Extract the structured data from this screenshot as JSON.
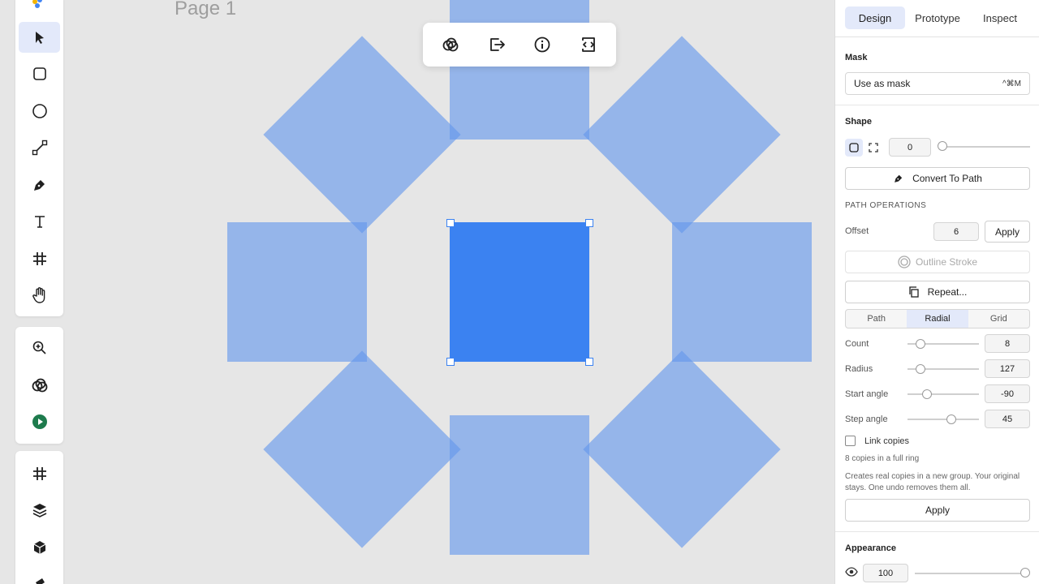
{
  "canvas": {
    "page_label": "Page 1"
  },
  "panel": {
    "tabs": [
      {
        "label": "Design",
        "active": true
      },
      {
        "label": "Prototype",
        "active": false
      },
      {
        "label": "Inspect",
        "active": false
      }
    ],
    "mask": {
      "title": "Mask",
      "use_as_mask": "Use as mask",
      "shortcut": "^⌘M"
    },
    "shape": {
      "title": "Shape",
      "corner_radius": "0",
      "convert_to_path": "Convert To Path",
      "path_operations_title": "PATH OPERATIONS",
      "offset_label": "Offset",
      "offset_value": "6",
      "offset_apply": "Apply",
      "outline_stroke": "Outline Stroke",
      "repeat": "Repeat..."
    },
    "repeat": {
      "modes": [
        {
          "label": "Path",
          "active": false
        },
        {
          "label": "Radial",
          "active": true
        },
        {
          "label": "Grid",
          "active": false
        }
      ],
      "count_label": "Count",
      "count_value": "8",
      "radius_label": "Radius",
      "radius_value": "127",
      "start_label": "Start angle",
      "start_value": "-90",
      "step_label": "Step angle",
      "step_value": "45",
      "link_copies": "Link copies",
      "summary": "8 copies in a full ring",
      "description": "Creates real copies in a new group. Your original stays. One undo removes them all.",
      "apply": "Apply"
    },
    "appearance": {
      "title": "Appearance",
      "opacity_value": "100",
      "opacity_level": 1.0
    }
  },
  "colors": {
    "accent": "#3b82f1",
    "copy_fill": "#6296ec",
    "canvas": "#e6e6e6"
  }
}
